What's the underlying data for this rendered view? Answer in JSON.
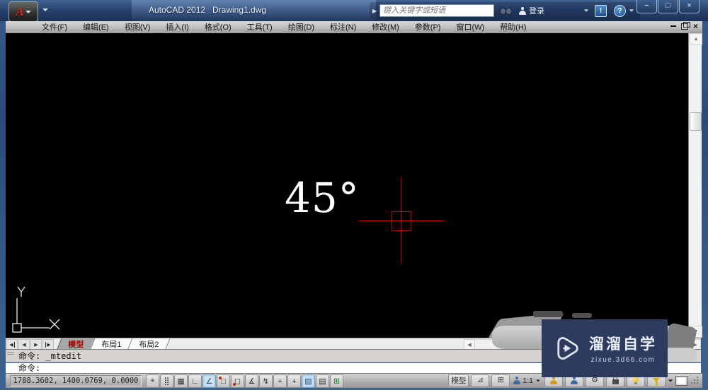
{
  "titlebar": {
    "app_title": "AutoCAD 2012",
    "doc_title": "Drawing1.dwg",
    "search_placeholder": "键入关键字或短语",
    "login_label": "登录",
    "logo_letter": "A",
    "expander_glyph": "▶",
    "alert_glyph": "!",
    "help_glyph": "?",
    "minimize_glyph": "−",
    "maximize_glyph": "□",
    "close_glyph": "×"
  },
  "menubar": {
    "items": [
      "文件(F)",
      "编辑(E)",
      "视图(V)",
      "插入(I)",
      "格式(O)",
      "工具(T)",
      "绘图(D)",
      "标注(N)",
      "修改(M)",
      "参数(P)",
      "窗口(W)",
      "帮助(H)"
    ],
    "doc_close_glyph": "×"
  },
  "canvas": {
    "angle_label": "45°",
    "ucs_x_label": "X",
    "ucs_y_label": "Y",
    "crosshair_color": "#c40000"
  },
  "scrollbar": {
    "up_glyph": "▲",
    "down_glyph": "▼",
    "left_glyph": "◀",
    "right_glyph": "▶"
  },
  "tabs": {
    "nav_first": "◀",
    "nav_prev": "◀",
    "nav_next": "▶",
    "nav_last": "▶",
    "items": [
      "模型",
      "布局1",
      "布局2"
    ],
    "active": "模型"
  },
  "command": {
    "history_line": "命令: _mtedit",
    "prompt_line": "命令:"
  },
  "statusbar": {
    "coordinates": "1788.3602, 1400.0769, 0.0000",
    "toggle_glyphs": [
      "⌖",
      "⣿",
      "▦",
      "∟",
      "∠",
      "□",
      "◻",
      "∡",
      "↯",
      "+",
      "+",
      "▨",
      "▤",
      "⊞"
    ],
    "model_button": "模型",
    "quick_view_layouts_glyph": "⊿",
    "quick_view_drawings_glyph": "⊞",
    "scale_label": "1:1",
    "tray_dropdown": "▼",
    "workspace_glyph": "⚙"
  },
  "watermark": {
    "title": "溜溜自学",
    "url": "zixue.3d66.com",
    "bg_color": "#2d3b5e"
  }
}
